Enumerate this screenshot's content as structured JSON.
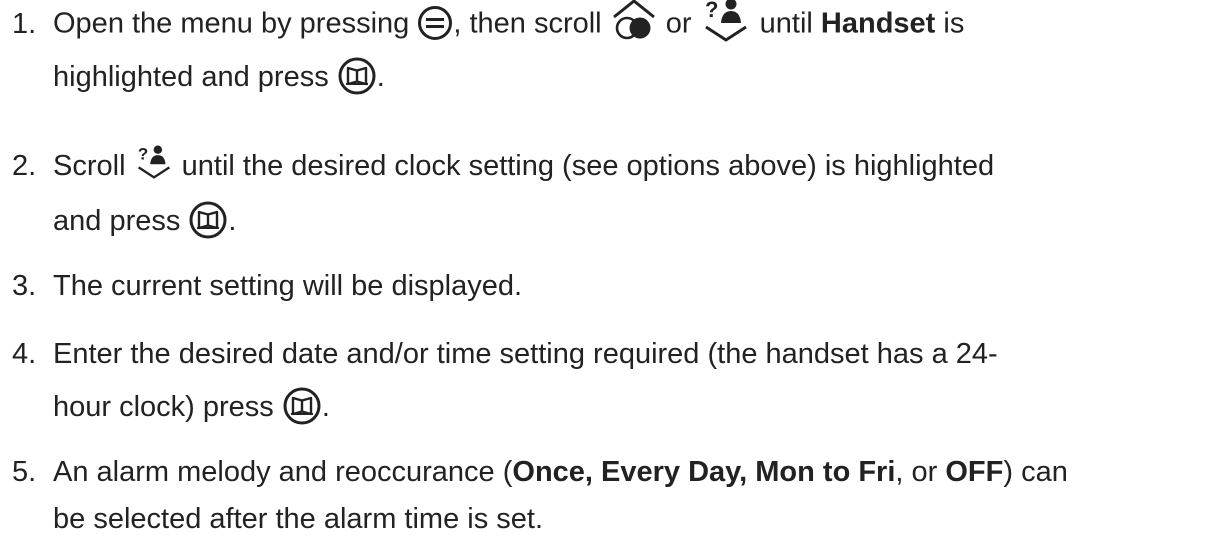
{
  "steps": [
    {
      "number": "1.",
      "p1": "Open the menu by pressing ",
      "p2": ", then scroll ",
      "p3": " or ",
      "p4": " until ",
      "bold1": "Handset",
      "p5": " is",
      "line2": "highlighted and press ",
      "end": "."
    },
    {
      "number": "2.",
      "p1": "Scroll ",
      "p2": " until the desired clock setting (see options above) is highlighted",
      "line2": "and press ",
      "end": "."
    },
    {
      "number": "3.",
      "p1": "The current setting will be displayed."
    },
    {
      "number": "4.",
      "p1": "Enter the desired date and/or time setting required (the handset has a 24-",
      "line2": "hour clock) press ",
      "end": "."
    },
    {
      "number": "5.",
      "p1": "An alarm melody and reoccurance (",
      "bold1": "Once, Every Day, Mon to Fri",
      "p2": ", or ",
      "bold2": "OFF",
      "p3": ") can",
      "line2": "be selected after the alarm time is set."
    }
  ],
  "icons": {
    "menu": "menu-button-icon",
    "scroll_up": "scroll-up-phonebook-icon",
    "scroll_down": "scroll-down-calllog-icon",
    "ok": "ok-book-button-icon"
  }
}
